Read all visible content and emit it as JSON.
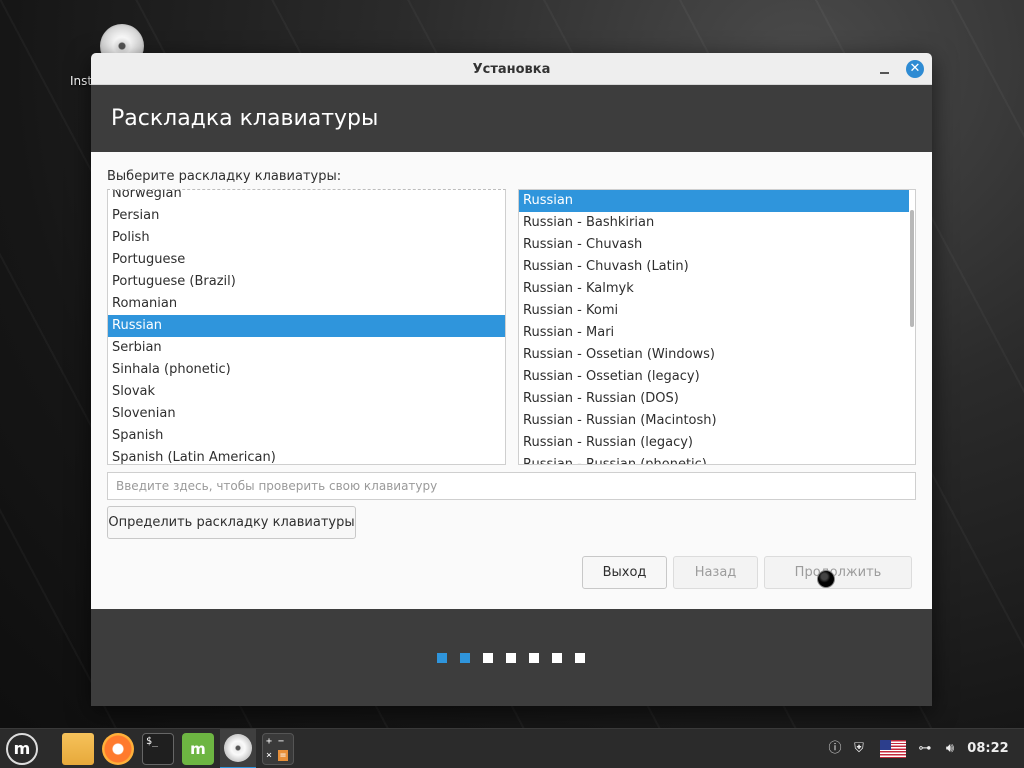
{
  "desktop": {
    "icon_label": "Inst"
  },
  "window": {
    "title": "Установка",
    "close_glyph": "✕"
  },
  "page": {
    "heading": "Раскладка клавиатуры",
    "prompt": "Выберите раскладку клавиатуры:"
  },
  "layouts": {
    "items": [
      "Norwegian",
      "Persian",
      "Polish",
      "Portuguese",
      "Portuguese (Brazil)",
      "Romanian",
      "Russian",
      "Serbian",
      "Sinhala (phonetic)",
      "Slovak",
      "Slovenian",
      "Spanish",
      "Spanish (Latin American)"
    ],
    "selected": "Russian"
  },
  "variants": {
    "items": [
      "Russian",
      "Russian - Bashkirian",
      "Russian - Chuvash",
      "Russian - Chuvash (Latin)",
      "Russian - Kalmyk",
      "Russian - Komi",
      "Russian - Mari",
      "Russian - Ossetian (Windows)",
      "Russian - Ossetian (legacy)",
      "Russian - Russian (DOS)",
      "Russian - Russian (Macintosh)",
      "Russian - Russian (legacy)",
      "Russian - Russian (phonetic)"
    ],
    "selected": "Russian"
  },
  "test_input": {
    "placeholder": "Введите здесь, чтобы проверить свою клавиатуру",
    "value": ""
  },
  "buttons": {
    "detect": "Определить раскладку клавиатуры",
    "quit": "Выход",
    "back": "Назад",
    "continue": "Продолжить"
  },
  "progress": {
    "total_steps": 7,
    "completed_steps": 2
  },
  "taskbar": {
    "apps": [
      "menu-icon",
      "files-icon",
      "firefox-icon",
      "terminal-icon",
      "mint-update-icon",
      "installer-icon",
      "calculator-icon"
    ],
    "active_app": "installer-icon",
    "clock": "08:22",
    "keyboard_layout_flag": "us-flag-icon"
  },
  "colors": {
    "accent": "#2f95dc",
    "header_bg": "#3d3d3d",
    "content_bg": "#fafafa"
  }
}
